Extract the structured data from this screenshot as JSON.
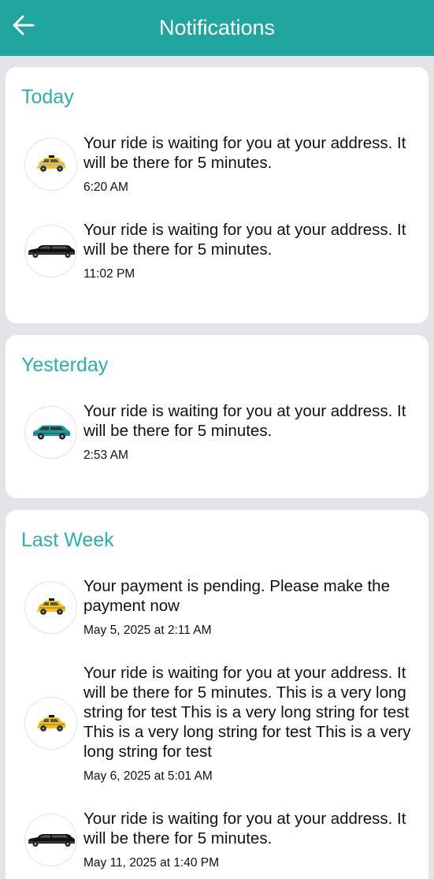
{
  "header": {
    "title": "Notifications",
    "back_icon": "arrow-left-icon"
  },
  "colors": {
    "header_bg": "#21a59f",
    "section_title": "#2bb0ab",
    "page_bg": "#e3e3e8"
  },
  "sections": [
    {
      "title": "Today",
      "items": [
        {
          "icon": "taxi-car-icon",
          "message": "Your ride is waiting for you at your address. It will be there for 5 minutes.",
          "time": "6:20 AM"
        },
        {
          "icon": "limousine-icon",
          "message": "Your ride is waiting for you at your address. It will be there for 5 minutes.",
          "time": "11:02 PM"
        }
      ]
    },
    {
      "title": "Yesterday",
      "items": [
        {
          "icon": "suv-car-icon",
          "message": "Your ride is waiting for you at your address. It will be there for 5 minutes.",
          "time": "2:53 AM"
        }
      ]
    },
    {
      "title": "Last Week",
      "items": [
        {
          "icon": "taxi-car-icon",
          "message": "Your payment is pending. Please make the payment now",
          "time": "May 5, 2025 at 2:11 AM"
        },
        {
          "icon": "taxi-car-icon",
          "message": "Your ride is waiting for you at your address. It will be there for 5 minutes. This is a very long string for test This is a very long string for test This is a very long string for test This is a very long string for test",
          "time": "May 6, 2025 at 5:01 AM"
        },
        {
          "icon": "limousine-icon",
          "message": "Your ride is waiting for you at your address. It will be there for 5 minutes.",
          "time": "May 11, 2025 at 1:40 PM"
        }
      ]
    }
  ]
}
